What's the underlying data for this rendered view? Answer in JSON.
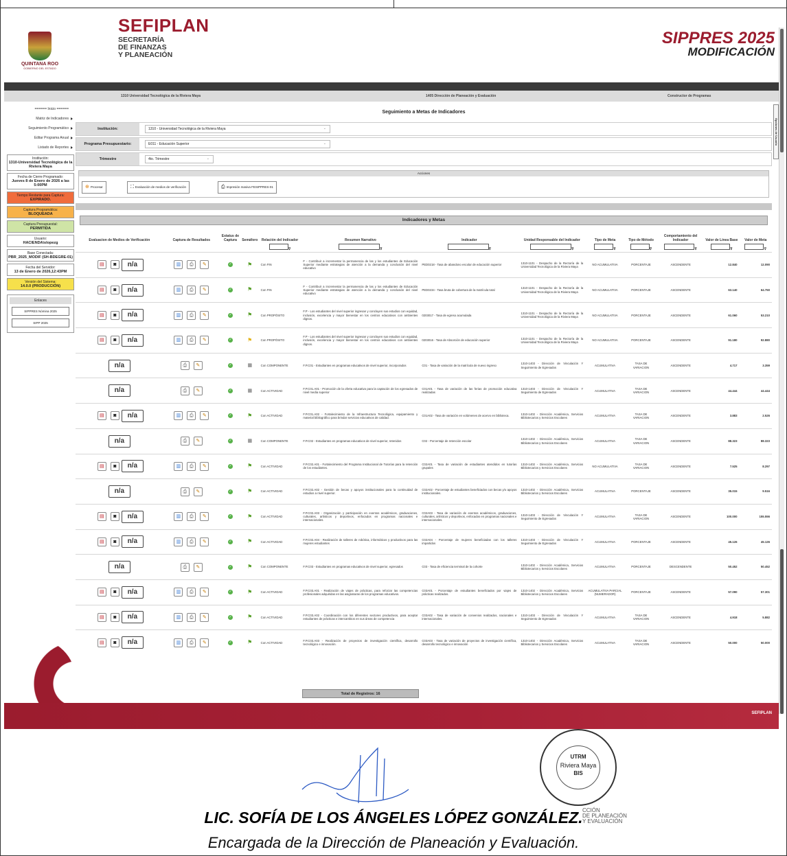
{
  "header": {
    "state_name": "QUINTANA ROO",
    "state_sub": "GOBIERNO DEL ESTADO",
    "sefiplan": "SEFIPLAN",
    "sef_l1": "SECRETARÍA",
    "sef_l2": "DE FINANZAS",
    "sef_l3": "Y PLANEACIÓN",
    "sippres": "SIPPRES 2025",
    "modificacion": "MODIFICACIÓN"
  },
  "context": {
    "ur": "1310 Universidad Tecnológica de la Riviera Maya",
    "area": "1405 Dirección de Planeación y Evaluación",
    "rol": "Constructor de Programas"
  },
  "sidebar": {
    "menu": [
      "====== Inicio ======",
      "Matriz de Indicadores",
      "Seguimiento Programático",
      "Editar Programa Anual",
      "Listado de Reportes"
    ],
    "institucion_label": "Institución:",
    "institucion_value": "1310-Universidad Tecnológica de la Riviera Maya",
    "cierre_label": "Fecha de Cierre Programado:",
    "cierre_value": "Jueves 8 de Enero de 2026 a las 5:00PM",
    "tiempo_label": "Tiempo Restante para Captura:",
    "tiempo_value": "EXPIRADO.",
    "capprog_label": "Captura Programática:",
    "capprog_value": "BLOQUEADA",
    "cappres_label": "Captura Presupuestal:",
    "cappres_value": "PERMITIDA",
    "usuario_label": "Usuario:",
    "usuario_value": "HACIENDA\\slopezg",
    "base_label": "Base Conectada:",
    "base_value": "PBR_2025_MODIF (SH-BDEGRE-01)",
    "servidor_label": "Fecha del Servidor:",
    "servidor_value": "13 de Enero de 2026,12:43PM",
    "version_label": "Versión del Sistema:",
    "version_value": "14.0.0 (PRODUCCIÓN)",
    "enlaces_label": "Enlaces",
    "enlace1": "SIPPRES Nómina 2025",
    "enlace2": "SIPP 2025"
  },
  "main": {
    "title": "Seguimiento a Metas de Indicadores",
    "institucion_label": "Institución:",
    "institucion_value": "1310 - Universidad Tecnológica de la Riviera Maya",
    "programa_label": "Programa Presupuestario:",
    "programa_value": "E011 - Educación Superior",
    "trimestre_label": "Trimestre",
    "trimestre_value": "4to. Trimestre",
    "acciones_label": "Acciones",
    "btn_procesar": "Procesar",
    "btn_evaluacion": "Evaluación de medios de verificación",
    "btn_impresion": "Impresión masiva FESIPPRES-01",
    "indicadores_label": "Indicadores y Metas",
    "opciones_label": "Opciones de Usuario",
    "total": "Total de Registros: 16"
  },
  "columns": [
    "Evaluacion de Medios de Verificación",
    "Captura de Resultados",
    "Estatus de Captura",
    "Semáforo",
    "Relación del Indicador",
    "Resumen Narrativo",
    "Indicador",
    "Unidad Responsable del Indicador",
    "Tipo de Meta",
    "Tipo de Método",
    "Comportamiento del Indicador",
    "Valor de Línea Base",
    "Valor de Meta"
  ],
  "rows": [
    {
      "eval": true,
      "flag": "g",
      "rel": "Con FIN",
      "resumen": "F - Contribuir a incrementar la permanencia de las y los estudiantes de Educación Superior mediante estrategias de atención a la demanda y conclusión del nivel educativo",
      "ind": "PED0218 - Tasa de abandono escolar de educación superior",
      "ur": "1310-1101 - Despacho de la Rectoría de la Universidad Tecnológica de la Riviera Maya",
      "tipo": "NO ACUMULATIVA",
      "metodo": "PORCENTAJE",
      "comp": "ASCENDENTE",
      "base": "12.840",
      "meta": "12.090"
    },
    {
      "eval": true,
      "flag": "g",
      "rel": "Con FIN",
      "resumen": "F - Contribuir a incrementar la permanencia de las y los estudiantes de Educación Superior mediante estrategias de atención a la demanda y conclusión del nivel educativo",
      "ind": "PED0234 - Tasa bruta de cobertura de la matrícula total",
      "ur": "1310-1101 - Despacho de la Rectoría de la Universidad Tecnológica de la Riviera Maya",
      "tipo": "NO ACUMULATIVA",
      "metodo": "PORCENTAJE",
      "comp": "ASCENDENTE",
      "base": "63.140",
      "meta": "64.750"
    },
    {
      "eval": true,
      "flag": "g",
      "rel": "Con PROPÓSITO",
      "resumen": "F.P - Los estudiantes del nivel superior ingresan y concluyen sus estudios con equidad, inclusión, excelencia y mayor bienestar en los centros educativos con ambientes dignos.",
      "ind": "0203017 - Tasa de egreso acumulada",
      "ur": "1310-1101 - Despacho de la Rectoría de la Universidad Tecnológica de la Riviera Maya",
      "tipo": "NO ACUMULATIVA",
      "metodo": "PORCENTAJE",
      "comp": "ASCENDENTE",
      "base": "61.060",
      "meta": "53.210"
    },
    {
      "eval": true,
      "flag": "y",
      "rel": "Con PROPÓSITO",
      "resumen": "F.P - Los estudiantes del nivel superior ingresan y concluyen sus estudios con equidad, inclusión, excelencia y mayor bienestar en los centros educativos con ambientes dignos.",
      "ind": "0203016 - Tasa de Absorción de educación superior",
      "ur": "1310-1101 - Despacho de la Rectoría de la Universidad Tecnológica de la Riviera Maya",
      "tipo": "NO ACUMULATIVA",
      "metodo": "PORCENTAJE",
      "comp": "ASCENDENTE",
      "base": "91.180",
      "meta": "92.880"
    },
    {
      "eval": false,
      "flag": "x",
      "rel": "Con COMPONENTE",
      "resumen": "F.P.C01 - Estudiantes en programas educativos de nivel superior, incorporados",
      "ind": "C01 - Tasa de variación de la matrícula de nuevo ingreso",
      "ur": "1310-1403 - Dirección de Vinculación Y Seguimiento de Egresados",
      "tipo": "ACUMULATIVA",
      "metodo": "TASA DE VARIACION",
      "comp": "ASCENDENTE",
      "base": "4.717",
      "meta": "3.359"
    },
    {
      "eval": false,
      "flag": "x",
      "rel": "Con ACTIVIDAD",
      "resumen": "F.P.C01.A01 - Promoción de la oferta educativa para la captación de los egresados de nivel media superior",
      "ind": "C01A01 - Tasa de variación de las ferias de promoción educativa realizadas",
      "ur": "1310-1403 - Dirección de Vinculación Y Seguimiento de Egresados",
      "tipo": "ACUMULATIVA",
      "metodo": "TASA DE VARIACION",
      "comp": "ASCENDENTE",
      "base": "44.444",
      "meta": "44.444"
    },
    {
      "eval": true,
      "flag": "g",
      "rel": "Con ACTIVIDAD",
      "resumen": "F.P.C01.A02 - Fortalecimiento de la Infraestructura Tecnológica, equipamiento y material bibliográfico para brindar servicios educativos de calidad.",
      "ind": "C01A02 - Tasa de variación en volúmenes de acervo en biblioteca.",
      "ur": "1310-1402 - Dirección Académica, Servicios Bibliotecarios y Servicios Escolares",
      "tipo": "ACUMULATIVA",
      "metodo": "TASA DE VARIACION",
      "comp": "ASCENDENTE",
      "base": "3.883",
      "meta": "2.526"
    },
    {
      "eval": false,
      "flag": "x",
      "rel": "Con COMPONENTE",
      "resumen": "F.P.C02 - Estudiantes en programas educativos de nivel superior, retenidos",
      "ind": "C02 - Porcentaje de retención escolar",
      "ur": "1310-1402 - Dirección Académica, Servicios Bibliotecarios y Servicios Escolares",
      "tipo": "ACUMULATIVA",
      "metodo": "TASA DE VARIACION",
      "comp": "ASCENDENTE",
      "base": "88.323",
      "meta": "88.323"
    },
    {
      "eval": true,
      "flag": "g",
      "rel": "Con ACTIVIDAD",
      "resumen": "F.P.C02.A01 - Fortalecimiento del Programa Institucional de Tutorías para la retención de los estudiantes.",
      "ind": "C02A01 - Tasa de variación de estudiantes atendidos en tutorías grupales",
      "ur": "1310-1402 - Dirección Académica, Servicios Bibliotecarios y Servicios Escolares",
      "tipo": "NO ACUMULATIVA",
      "metodo": "TASA DE VARIACION",
      "comp": "ASCENDENTE",
      "base": "7.525",
      "meta": "8.297"
    },
    {
      "eval": false,
      "flag": "g",
      "rel": "Con ACTIVIDAD",
      "resumen": "F.P.C02.A02 - Gestión de becas y apoyos institucionales para la continuidad de estudios a nivel superior.",
      "ind": "C02A02 - Porcentaje de estudiantes beneficiados con becas y/o apoyos institucionales.",
      "ur": "1310-1402 - Dirección Académica, Servicios Bibliotecarios y Servicios Escolares",
      "tipo": "ACUMULATIVA",
      "metodo": "PORCENTAJE",
      "comp": "ASCENDENTE",
      "base": "35.015",
      "meta": "9.516"
    },
    {
      "eval": true,
      "flag": "g",
      "rel": "Con ACTIVIDAD",
      "resumen": "F.P.C02.A03 - Organización y participación en eventos académicos, graduaciones, culturales, artísticos y deportivos, enfocados en programas nacionales e internacionales.",
      "ind": "C02A03 - Tasa de variación de eventos académicos, graduaciones, culturales, artísticos y deportivos, enfocados en programas nacionales e internacionales.",
      "ur": "1310-1403 - Dirección de Vinculación Y Seguimiento de Egresados",
      "tipo": "ACUMULATIVA",
      "metodo": "TASA DE VARIACION",
      "comp": "ASCENDENTE",
      "base": "100.000",
      "meta": "155.556"
    },
    {
      "eval": true,
      "flag": "g",
      "rel": "Con ACTIVIDAD",
      "resumen": "F.P.C02.A04 - Realización de talleres de robótica, informáticos y productivos para las mujeres estudiantes",
      "ind": "C02A04 - Porcentaje de mujeres beneficiadas con los talleres impartidos",
      "ur": "1310-1403 - Dirección de Vinculación Y Seguimiento de Egresados",
      "tipo": "ACUMULATIVA",
      "metodo": "PORCENTAJE",
      "comp": "ASCENDENTE",
      "base": "45.126",
      "meta": "45.126"
    },
    {
      "eval": false,
      "flag": "g",
      "rel": "Con COMPONENTE",
      "resumen": "F.P.C03 - Estudiantes en programas educativos de nivel superior, egresados",
      "ind": "C03 - Tasa de eficiencia terminal de la cohorte",
      "ur": "1310-1402 - Dirección Académica, Servicios Bibliotecarios y Servicios Escolares",
      "tipo": "ACUMULATIVA",
      "metodo": "PORCENTAJE",
      "comp": "DESCENDENTE",
      "base": "50.452",
      "meta": "50.452"
    },
    {
      "eval": true,
      "flag": "g",
      "rel": "Con ACTIVIDAD",
      "resumen": "F.P.C03.A01 - Realización de viajes de prácticas, para reforzar las competencias profesionales adquiridas en las asignaturas de los programas educativos.",
      "ind": "C03A01 - Porcentaje de estudiantes beneficiados por viajes de prácticas realizados.",
      "ur": "1310-1402 - Dirección Académica, Servicios Bibliotecarios y Servicios Escolares",
      "tipo": "ACUMULATIVA PARCIAL (NUMERADOR)",
      "metodo": "PORCENTAJE",
      "comp": "ASCENDENTE",
      "base": "57.090",
      "meta": "57.301"
    },
    {
      "eval": true,
      "flag": "g",
      "rel": "Con ACTIVIDAD",
      "resumen": "F.P.C03.A02 - Coordinación con los diferentes sectores productivos, para aceptar estudiantes de prácticas e intercambios en sus áreas de competencia",
      "ind": "C03A02 - Tasa de variación de convenios realizados, nacionales e internacionales.",
      "ur": "1310-1403 - Dirección de Vinculación Y Seguimiento de Egresados",
      "tipo": "ACUMULATIVA",
      "metodo": "TASA DE VARIACION",
      "comp": "ASCENDENTE",
      "base": "4.918",
      "meta": "5.882"
    },
    {
      "eval": true,
      "flag": "g",
      "rel": "Con ACTIVIDAD",
      "resumen": "F.P.C03.A03 - Realización de proyectos de investigación científica, desarrollo tecnológico e innovación.",
      "ind": "C03A03 - Tasa de variación de proyectos de investigación científica, desarrollo tecnológico e innovación",
      "ur": "1310-1402 - Dirección Académica, Servicios Bibliotecarios y Servicios Escolares",
      "tipo": "ACUMULATIVA",
      "metodo": "TASA DE VARIACION",
      "comp": "ASCENDENTE",
      "base": "50.000",
      "meta": "50.000"
    }
  ],
  "na": "n/a",
  "footer": {
    "brand": "SEFIPLAN"
  },
  "signature": {
    "name": "LIC. SOFÍA DE LOS ÁNGELES LÓPEZ GONZÁLEZ.",
    "role": "Encargada de la Dirección de Planeación y Evaluación.",
    "seal_l1": "UTRM",
    "seal_l2": "Riviera Maya",
    "seal_l3": "BIS",
    "stamp": "CCIÓN\nDE PLANEACIÓN\nY EVALUACIÓN"
  }
}
